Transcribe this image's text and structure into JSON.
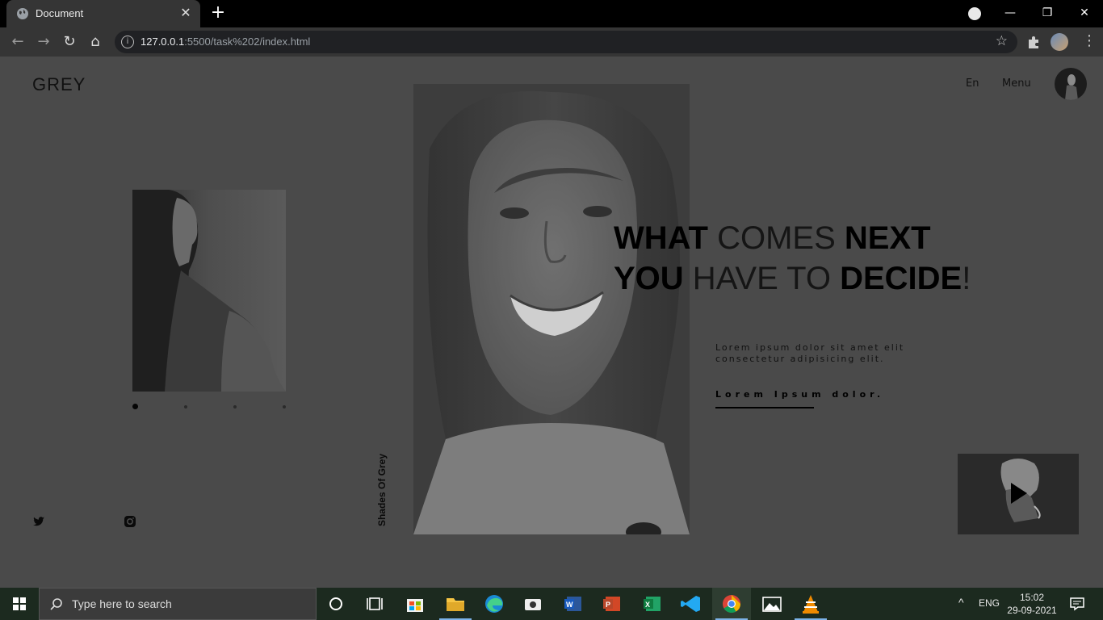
{
  "browser": {
    "tab_title": "Document",
    "close_glyph": "✕",
    "newtab_glyph": "+",
    "url_host": "127.0.0.1",
    "url_rest": ":5500/task%202/index.html",
    "info_glyph": "i",
    "star_glyph": "☆",
    "back_glyph": "←",
    "forward_glyph": "→",
    "reload_glyph": "↻",
    "home_glyph": "⌂",
    "kebab_glyph": "⋮",
    "minimize_glyph": "—",
    "restore_glyph": "❐",
    "winclose_glyph": "✕",
    "icons": [
      "globe-icon",
      "close-icon",
      "plus-icon",
      "back-icon",
      "forward-icon",
      "reload-icon",
      "home-icon",
      "info-icon",
      "star-icon",
      "puzzle-icon",
      "profile-avatar",
      "kebab-icon"
    ]
  },
  "page": {
    "logo": "GREY",
    "nav": {
      "lang": "En",
      "menu": "Menu"
    },
    "vertical_text": "Shades Of Grey",
    "headline": {
      "line1_bold1": "WHAT",
      "line1_light": " COMES ",
      "line1_bold2": "NEXT",
      "line2_bold1": "YOU",
      "line2_light": " HAVE TO ",
      "line2_bold2": "DECIDE",
      "line2_end": "!"
    },
    "description": "Lorem ipsum dolor sit amet elit consectetur adipisicing elit.",
    "cta": "Lorem Ipsum dolor.",
    "slider": {
      "count": 4,
      "active_index": 0
    },
    "social": [
      "twitter-icon",
      "instagram-icon"
    ]
  },
  "taskbar": {
    "search_placeholder": "Type here to search",
    "lang": "ENG",
    "time": "15:02",
    "date": "29-09-2021",
    "chevron": "^",
    "apps": [
      "cortana-icon",
      "task-view-icon",
      "store-icon",
      "file-explorer-icon",
      "edge-icon",
      "camera-icon",
      "word-icon",
      "powerpoint-icon",
      "excel-icon",
      "vscode-icon",
      "chrome-icon",
      "photos-icon",
      "vlc-icon"
    ]
  },
  "colors": {
    "page_bg": "#4a4a4a",
    "chrome_bg": "#353535",
    "taskbar_bg": "#1c2a1f"
  }
}
